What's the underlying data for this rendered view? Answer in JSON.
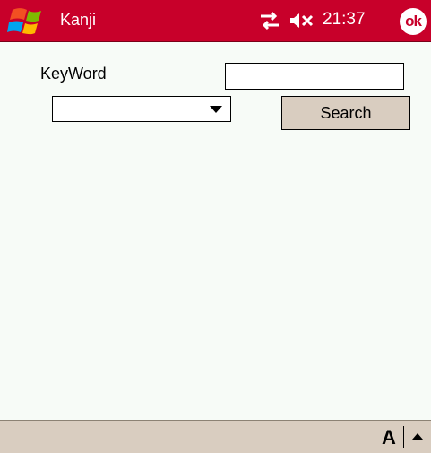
{
  "titlebar": {
    "title": "Kanji",
    "clock": "21:37",
    "ok_label": "ok",
    "color": "#c8002a",
    "icons": {
      "start": "windows-start-icon",
      "connectivity": "connectivity-icon",
      "volume": "volume-muted-icon"
    }
  },
  "form": {
    "keyword_label": "KeyWord",
    "keyword_value": "",
    "category_value": "",
    "search_label": "Search"
  },
  "bottombar": {
    "input_method_label": "A",
    "background": "#d9cdc0",
    "icons": {
      "sip_toggle": "sip-up-arrow-icon"
    }
  }
}
